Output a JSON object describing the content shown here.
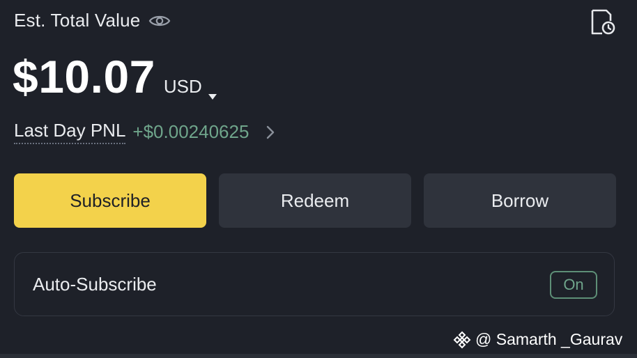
{
  "header": {
    "title": "Est. Total Value",
    "visibility_icon": "eye-icon",
    "history_icon": "document-clock-icon"
  },
  "balance": {
    "value": "$10.07",
    "currency": "USD",
    "currency_dropdown_icon": "caret-down-icon"
  },
  "pnl": {
    "label": "Last Day PNL",
    "value": "+$0.00240625",
    "value_color": "#6fa58b",
    "chevron_icon": "chevron-right-icon"
  },
  "actions": {
    "subscribe": "Subscribe",
    "redeem": "Redeem",
    "borrow": "Borrow",
    "accent_color": "#f3d24b"
  },
  "auto_subscribe": {
    "label": "Auto-Subscribe",
    "toggle_state": "On"
  },
  "watermark": {
    "text": "@ Samarth _Gaurav",
    "logo_icon": "binance-logo-icon"
  }
}
